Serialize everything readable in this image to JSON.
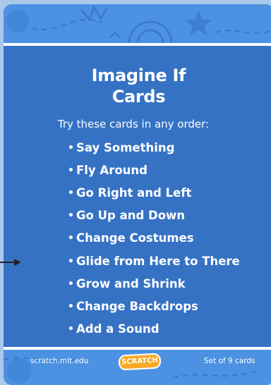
{
  "card": {
    "title_line1": "Imagine If",
    "title_line2": "Cards",
    "subtitle": "Try these cards in any order:",
    "items": [
      "Say Something",
      "Fly Around",
      "Go Right and Left",
      "Go Up and Down",
      "Change Costumes",
      "Glide from Here to There",
      "Grow and Shrink",
      "Change Backdrops",
      "Add a Sound"
    ],
    "bullet": "•",
    "footer_left": "scratch.mit.edu",
    "logo_text": "SCRATCH",
    "footer_right": "Set of 9 cards"
  },
  "colors": {
    "card_background": "#3572c4",
    "band": "#4d92e2",
    "page_background": "#a9c8ea",
    "logo": "#f9a825"
  }
}
